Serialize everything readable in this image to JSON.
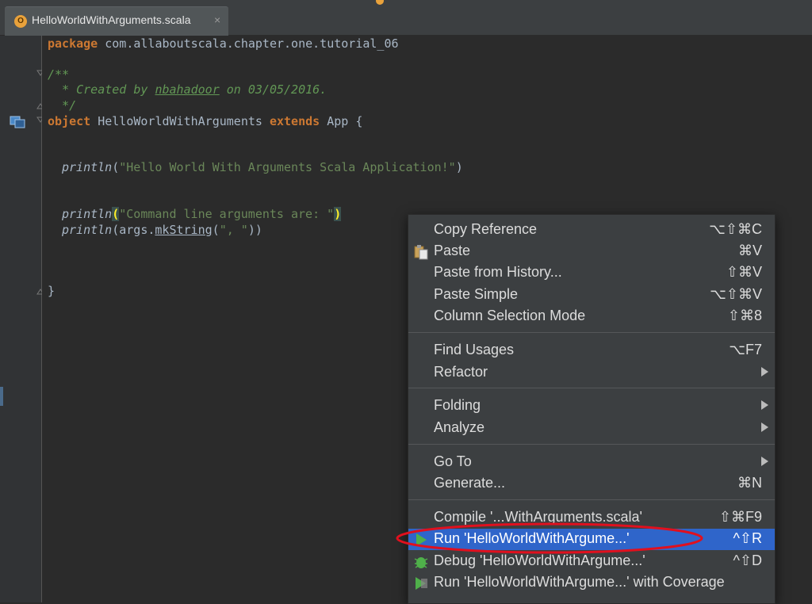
{
  "tab": {
    "icon_letter": "O",
    "title": "HelloWorldWithArguments.scala",
    "close_glyph": "×"
  },
  "code": {
    "line1_kw": "package",
    "line1_rest": " com.allaboutscala.chapter.one.tutorial_06",
    "line2": "/**",
    "line3_prefix": "  * Created by ",
    "line3_author": "nbahadoor",
    "line3_suffix": " on 03/05/2016.",
    "line4": "  */",
    "line5_kw1": "object",
    "line5_name": " HelloWorldWithArguments ",
    "line5_kw2": "extends",
    "line5_rest": " App {",
    "line6_fn": "println",
    "line6_open": "(",
    "line6_str": "\"Hello World With Arguments Scala Application!\"",
    "line6_close": ")",
    "line7_fn": "println",
    "line7_open": "(",
    "line7_str": "\"Command line arguments are: \"",
    "line7_close": ")",
    "line8_fn": "println",
    "line8_mid": "(args.",
    "line8_method": "mkString",
    "line8_open": "(",
    "line8_str": "\", \"",
    "line8_close": "))",
    "line9": "}"
  },
  "menu": {
    "items": [
      {
        "label": "Copy Reference",
        "shortcut": "⌥⇧⌘C"
      },
      {
        "label": "Paste",
        "shortcut": "⌘V",
        "icon": "paste-icon"
      },
      {
        "label": "Paste from History...",
        "shortcut": "⇧⌘V"
      },
      {
        "label": "Paste Simple",
        "shortcut": "⌥⇧⌘V"
      },
      {
        "label": "Column Selection Mode",
        "shortcut": "⇧⌘8"
      },
      {
        "label": "Find Usages",
        "shortcut": "⌥F7"
      },
      {
        "label": "Refactor",
        "submenu": true
      },
      {
        "label": "Folding",
        "submenu": true
      },
      {
        "label": "Analyze",
        "submenu": true
      },
      {
        "label": "Go To",
        "submenu": true
      },
      {
        "label": "Generate...",
        "shortcut": "⌘N"
      },
      {
        "label": "Compile '...WithArguments.scala'",
        "shortcut": "⇧⌘F9"
      },
      {
        "label": "Run 'HelloWorldWithArgume...'",
        "shortcut": "^⇧R",
        "icon": "run-icon",
        "selected": true
      },
      {
        "label": "Debug 'HelloWorldWithArgume...'",
        "shortcut": "^⇧D",
        "icon": "debug-icon"
      },
      {
        "label": "Run 'HelloWorldWithArgume...' with Coverage",
        "icon": "coverage-icon"
      }
    ]
  },
  "colors": {
    "selection": "#2f65ca",
    "highlight_ellipse": "#e0101e",
    "keyword": "#cc7832",
    "string": "#6a8759",
    "comment": "#629755"
  }
}
